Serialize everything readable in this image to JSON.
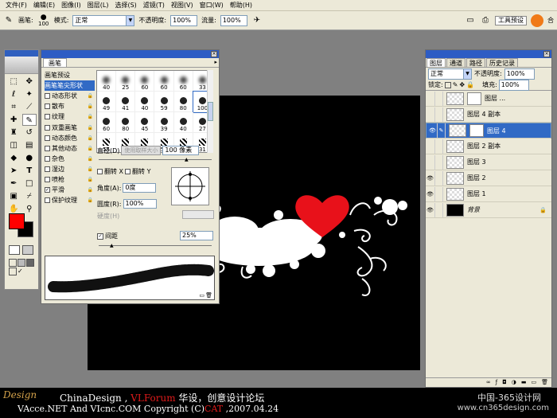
{
  "menu": [
    "文件(F)",
    "编辑(E)",
    "图像(I)",
    "图层(L)",
    "选择(S)",
    "滤镜(T)",
    "视图(V)",
    "窗口(W)",
    "帮助(H)"
  ],
  "options": {
    "brush_label": "画笔:",
    "brush_size": "100",
    "mode_label": "模式:",
    "mode_value": "正常",
    "opacity_label": "不透明度:",
    "opacity_value": "100%",
    "flow_label": "流量:",
    "flow_value": "100%",
    "tool_preset_tab": "工具预设",
    "right_tab": "合"
  },
  "brushes": {
    "tab": "画笔",
    "list": [
      {
        "label": "画笔预设",
        "check": "none",
        "lock": false
      },
      {
        "label": "画笔笔尖形状",
        "check": "none",
        "lock": false,
        "active": true
      },
      {
        "label": "动态形状",
        "check": "off",
        "lock": true
      },
      {
        "label": "散布",
        "check": "off",
        "lock": true
      },
      {
        "label": "纹理",
        "check": "off",
        "lock": true
      },
      {
        "label": "双重画笔",
        "check": "off",
        "lock": true
      },
      {
        "label": "动态颜色",
        "check": "off",
        "lock": true
      },
      {
        "label": "其他动态",
        "check": "off",
        "lock": true
      },
      {
        "label": "杂色",
        "check": "off",
        "lock": true
      },
      {
        "label": "湿边",
        "check": "off",
        "lock": true
      },
      {
        "label": "喷枪",
        "check": "off",
        "lock": true
      },
      {
        "label": "平滑",
        "check": "on",
        "lock": true
      },
      {
        "label": "保护纹理",
        "check": "off",
        "lock": true
      }
    ],
    "grid": [
      "40",
      "25",
      "60",
      "60",
      "60",
      "33",
      "49",
      "41",
      "40",
      "59",
      "80",
      "100",
      "60",
      "80",
      "45",
      "39",
      "40",
      "27",
      "55",
      "36",
      "57",
      "59",
      "43",
      "31"
    ],
    "diameter_label": "直径(D)",
    "use_sample_label": "使用取样大小",
    "diameter_value": "100 像素",
    "flip_x": "翻转 X",
    "flip_y": "翻转 Y",
    "angle_label": "角度(A):",
    "angle_value": "0度",
    "roundness_label": "圆度(R):",
    "roundness_value": "100%",
    "hardness_label": "硬度(H)",
    "spacing_label": "间距",
    "spacing_value": "25%"
  },
  "layers": {
    "tabs": [
      "图层",
      "通道",
      "路径",
      "历史记录"
    ],
    "blend": "正常",
    "opacity_label": "不透明度:",
    "opacity_value": "100%",
    "lock_label": "锁定:",
    "fill_label": "填充:",
    "fill_value": "100%",
    "rows": [
      {
        "name": "图层 ...",
        "eye": false,
        "mask": true,
        "selected": false,
        "black": false,
        "lock": false
      },
      {
        "name": "图层 4 副本",
        "eye": false,
        "mask": false,
        "selected": false,
        "black": false,
        "lock": false
      },
      {
        "name": "图层 4",
        "eye": true,
        "mask": true,
        "selected": true,
        "black": false,
        "lock": false
      },
      {
        "name": "图层 2 副本",
        "eye": false,
        "mask": false,
        "selected": false,
        "black": false,
        "lock": false
      },
      {
        "name": "图层 3",
        "eye": false,
        "mask": false,
        "selected": false,
        "black": false,
        "lock": false
      },
      {
        "name": "图层 2",
        "eye": true,
        "mask": false,
        "selected": false,
        "black": false,
        "lock": false
      },
      {
        "name": "图层 1",
        "eye": true,
        "mask": false,
        "selected": false,
        "black": false,
        "lock": false
      },
      {
        "name": "背景",
        "eye": true,
        "mask": false,
        "selected": false,
        "black": true,
        "lock": true
      }
    ]
  },
  "footer": {
    "line1a": "ChinaDesign",
    "line1b": " , ",
    "line1c": "VLForum",
    "line1d": " 华设，创意设计论坛",
    "line2": "VAcce.NET  And  VIcnc.COM  Copyright (C)",
    "line2b": "CAT",
    "line2c": " ,2007.04.24",
    "brand": "中国-365设计网",
    "url": "www.cn365design.com",
    "logo": "Design"
  },
  "colors": {
    "accent": "#316ac5",
    "heart": "#e8111a"
  }
}
